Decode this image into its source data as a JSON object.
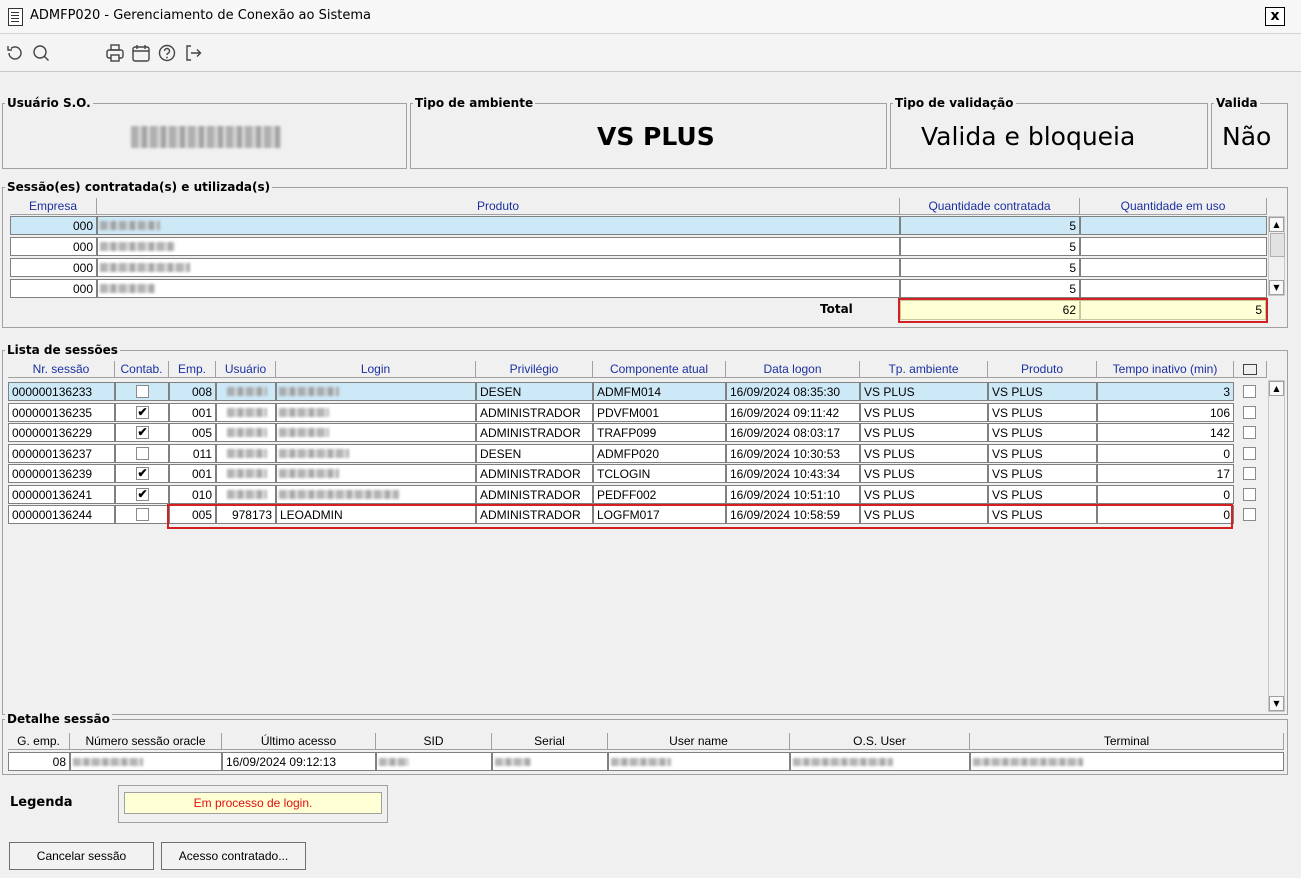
{
  "window": {
    "title": "ADMFP020 - Gerenciamento de Conexão ao Sistema",
    "close": "x"
  },
  "toolbar": {
    "icons": [
      "refresh-icon",
      "search-icon",
      "print-icon",
      "calendar-icon",
      "help-icon",
      "exit-icon"
    ]
  },
  "info": {
    "usuario_label": "Usuário S.O.",
    "tipo_ambiente_label": "Tipo de ambiente",
    "tipo_ambiente_value": "VS PLUS",
    "tipo_validacao_label": "Tipo de validação",
    "tipo_validacao_value": "Valida e bloqueia",
    "valida_label": "Valida",
    "valida_value": "Não"
  },
  "sessoes_contratadas": {
    "title": "Sessão(es) contratada(s) e utilizada(s)",
    "headers": [
      "Empresa",
      "Produto",
      "Quantidade contratada",
      "Quantidade em uso"
    ],
    "rows": [
      {
        "empresa": "000",
        "contratada": "5",
        "uso": ""
      },
      {
        "empresa": "000",
        "contratada": "5",
        "uso": ""
      },
      {
        "empresa": "000",
        "contratada": "5",
        "uso": ""
      },
      {
        "empresa": "000",
        "contratada": "5",
        "uso": ""
      }
    ],
    "total_label": "Total",
    "total_contratada": "62",
    "total_uso": "5"
  },
  "lista": {
    "title": "Lista de sessões",
    "headers": [
      "Nr. sessão",
      "Contab.",
      "Emp.",
      "Usuário",
      "Login",
      "Privilégio",
      "Componente atual",
      "Data logon",
      "Tp. ambiente",
      "Produto",
      "Tempo inativo (min)"
    ],
    "rows": [
      {
        "nr": "000000136233",
        "contab": "",
        "emp": "008",
        "usuario": "",
        "login": "",
        "priv": "DESEN",
        "comp": "ADMFM014",
        "data": "16/09/2024 08:35:30",
        "tp": "VS PLUS",
        "prod": "VS PLUS",
        "tempo": "3"
      },
      {
        "nr": "000000136235",
        "contab": "✔",
        "emp": "001",
        "usuario": "",
        "login": "",
        "priv": "ADMINISTRADOR",
        "comp": "PDVFM001",
        "data": "16/09/2024 09:11:42",
        "tp": "VS PLUS",
        "prod": "VS PLUS",
        "tempo": "106"
      },
      {
        "nr": "000000136229",
        "contab": "✔",
        "emp": "005",
        "usuario": "",
        "login": "",
        "priv": "ADMINISTRADOR",
        "comp": "TRAFP099",
        "data": "16/09/2024 08:03:17",
        "tp": "VS PLUS",
        "prod": "VS PLUS",
        "tempo": "142"
      },
      {
        "nr": "000000136237",
        "contab": "",
        "emp": "011",
        "usuario": "",
        "login": "",
        "priv": "DESEN",
        "comp": "ADMFP020",
        "data": "16/09/2024 10:30:53",
        "tp": "VS PLUS",
        "prod": "VS PLUS",
        "tempo": "0"
      },
      {
        "nr": "000000136239",
        "contab": "✔",
        "emp": "001",
        "usuario": "",
        "login": "",
        "priv": "ADMINISTRADOR",
        "comp": "TCLOGIN",
        "data": "16/09/2024 10:43:34",
        "tp": "VS PLUS",
        "prod": "VS PLUS",
        "tempo": "17"
      },
      {
        "nr": "000000136241",
        "contab": "✔",
        "emp": "010",
        "usuario": "",
        "login": "",
        "priv": "ADMINISTRADOR",
        "comp": "PEDFF002",
        "data": "16/09/2024 10:51:10",
        "tp": "VS PLUS",
        "prod": "VS PLUS",
        "tempo": "0"
      },
      {
        "nr": "000000136244",
        "contab": "",
        "emp": "005",
        "usuario": "978173",
        "login": "LEOADMIN",
        "priv": "ADMINISTRADOR",
        "comp": "LOGFM017",
        "data": "16/09/2024 10:58:59",
        "tp": "VS PLUS",
        "prod": "VS PLUS",
        "tempo": "0"
      }
    ]
  },
  "detalhe": {
    "title": "Detalhe sessão",
    "headers": [
      "G. emp.",
      "Número sessão oracle",
      "Último acesso",
      "SID",
      "Serial",
      "User name",
      "O.S. User",
      "Terminal"
    ],
    "g_emp": "08",
    "ultimo_acesso": "16/09/2024 09:12:13"
  },
  "legenda": {
    "label": "Legenda",
    "text": "Em processo de login."
  },
  "buttons": {
    "cancelar": "Cancelar sessão",
    "acesso": "Acesso contratado..."
  }
}
